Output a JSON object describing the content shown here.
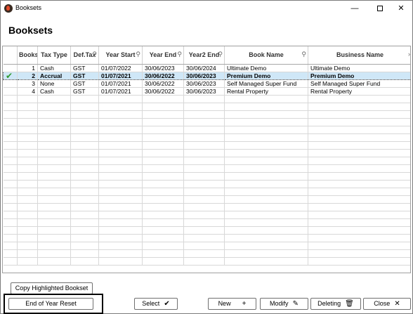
{
  "window": {
    "title": "Booksets"
  },
  "heading": "Booksets",
  "columns": [
    "Books",
    "Tax Type",
    "Def.Tax",
    "Year Start",
    "Year End",
    "Year2 End",
    "Book Name",
    "Business Name"
  ],
  "rows": [
    {
      "num": "1",
      "tax": "Cash",
      "def": "GST",
      "start": "01/07/2022",
      "end": "30/06/2023",
      "end2": "30/06/2024",
      "name": "Ultimate Demo",
      "business": "Ultimate Demo",
      "selected": false
    },
    {
      "num": "2",
      "tax": "Accrual",
      "def": "GST",
      "start": "01/07/2021",
      "end": "30/06/2022",
      "end2": "30/06/2023",
      "name": "Premium Demo",
      "business": "Premium Demo",
      "selected": true
    },
    {
      "num": "3",
      "tax": "None",
      "def": "GST",
      "start": "01/07/2021",
      "end": "30/06/2022",
      "end2": "30/06/2023",
      "name": "Self Managed Super Fund",
      "business": "Self Managed Super Fund",
      "selected": false
    },
    {
      "num": "4",
      "tax": "Cash",
      "def": "GST",
      "start": "01/07/2021",
      "end": "30/06/2022",
      "end2": "30/06/2023",
      "name": "Rental Property",
      "business": "Rental Property",
      "selected": false
    }
  ],
  "buttons": {
    "copy": "Copy Highlighted Bookset",
    "eoy": "End of Year Reset",
    "select": "Select",
    "new": "New",
    "modify": "Modify",
    "deleting": "Deleting",
    "close": "Close"
  },
  "icons": {
    "check": "checkmark-icon",
    "plus": "plus-icon",
    "pencil": "pencil-icon",
    "trash": "trash-icon",
    "close": "close-icon"
  }
}
